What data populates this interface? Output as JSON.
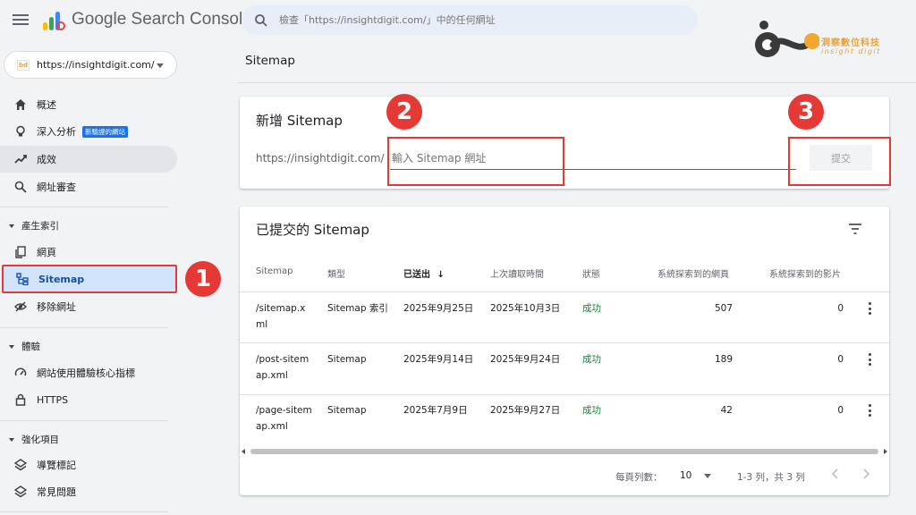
{
  "app": {
    "brand": "Google Search Console",
    "search_placeholder": "檢查「https://insightdigit.com/」中的任何網址"
  },
  "corner_logo": {
    "title": "洞察數位科技",
    "subtitle": "insight digit"
  },
  "property": {
    "favicon_text": "bd",
    "label": "https://insightdigit.com/"
  },
  "sidebar": {
    "items": [
      {
        "label": "概述",
        "icon": "home-icon"
      },
      {
        "label": "深入分析",
        "icon": "lightbulb-icon",
        "badge": "新驗證的網站"
      },
      {
        "label": "成效",
        "icon": "trending-up-icon"
      },
      {
        "label": "網址審查",
        "icon": "search-icon"
      }
    ],
    "section_indexing": "產生索引",
    "indexing_items": [
      {
        "label": "網頁",
        "icon": "pages-icon"
      },
      {
        "label": "Sitemap",
        "icon": "sitemap-icon"
      },
      {
        "label": "移除網址",
        "icon": "eye-off-icon"
      }
    ],
    "section_experience": "體驗",
    "experience_items": [
      {
        "label": "網站使用體驗核心指標",
        "icon": "gauge-icon"
      },
      {
        "label": "HTTPS",
        "icon": "lock-icon"
      }
    ],
    "section_enhancements": "強化項目",
    "enhancement_items": [
      {
        "label": "導覽標記",
        "icon": "layers-icon"
      },
      {
        "label": "常見問題",
        "icon": "layers-icon"
      }
    ]
  },
  "callouts": {
    "one": "1",
    "two": "2",
    "three": "3"
  },
  "main": {
    "page_title": "Sitemap",
    "add_card": {
      "title": "新增 Sitemap",
      "prefix": "https://insightdigit.com/",
      "input_placeholder": "輸入 Sitemap 網址",
      "submit_label": "提交"
    },
    "submitted_card": {
      "title": "已提交的 Sitemap",
      "columns": [
        "Sitemap",
        "類型",
        "已送出",
        "上次讀取時間",
        "狀態",
        "系統探索到的網頁",
        "系統探索到的影片"
      ],
      "sort_arrow": "↓",
      "rows": [
        {
          "sitemap_l1": "/sitemap.x",
          "sitemap_l2": "ml",
          "type": "Sitemap 索引",
          "submitted": "2025年9月25日",
          "last_read": "2025年10月3日",
          "status": "成功",
          "pages": "507",
          "videos": "0"
        },
        {
          "sitemap_l1": "/post-sitem",
          "sitemap_l2": "ap.xml",
          "type": "Sitemap",
          "submitted": "2025年9月14日",
          "last_read": "2025年9月24日",
          "status": "成功",
          "pages": "189",
          "videos": "0"
        },
        {
          "sitemap_l1": "/page-sitem",
          "sitemap_l2": "ap.xml",
          "type": "Sitemap",
          "submitted": "2025年7月9日",
          "last_read": "2025年9月27日",
          "status": "成功",
          "pages": "42",
          "videos": "0"
        }
      ],
      "pager": {
        "rows_per_page_label": "每頁列數：",
        "rows_per_page": "10",
        "range": "1-3 列，共 3 列"
      }
    }
  },
  "colors": {
    "accent": "#1a73e8",
    "callout": "#e53935",
    "success": "#188038",
    "selected_bg": "#d2e3fc"
  }
}
